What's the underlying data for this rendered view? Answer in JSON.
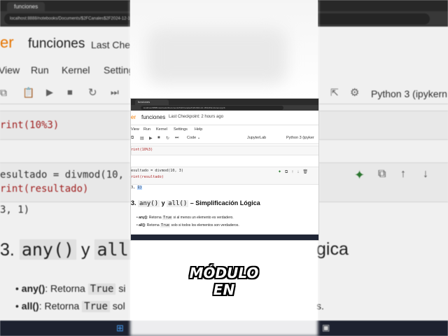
{
  "background": {
    "browser_tab": "funciones",
    "url": "localhost:8888/notebooks/Documents/$2FCanales$2F2024-12-16$2FFunciones.ipynb",
    "notebook_title": "funciones",
    "checkpoint": "Last Checkpoint",
    "logo_fragment": "er",
    "menu": [
      "View",
      "Run",
      "Kernel",
      "Setting"
    ],
    "kernel": "Python 3 (ipykern",
    "code_line_1": "rint(10%3)",
    "code_line_2": "esultado = divmod(10, 3",
    "code_line_3": "rint(resultado)",
    "output": "3, 1)",
    "heading_num": "3.",
    "heading_any": "any()",
    "heading_y": "y",
    "heading_all": "all",
    "heading_tail": "gica",
    "bullet_any_label": "any()",
    "bullet_any_text": ": Retorna",
    "bullet_any_code": "True",
    "bullet_any_rest": "si",
    "bullet_all_label": "all()",
    "bullet_all_text": ": Retorna",
    "bullet_all_code": "True",
    "bullet_all_rest": "sol",
    "bullet_all_end": "s."
  },
  "inner": {
    "browser_tab": "funciones",
    "url": "localhost:8888/notebooks/Documents/%2FCanales%2F2024-12-16%2Ffunciones.ipynb",
    "logo": "er",
    "notebook_title": "funciones",
    "checkpoint": "Last Checkpoint: 2 hours ago",
    "menu": [
      "View",
      "Run",
      "Kernel",
      "Settings",
      "Help"
    ],
    "cell_type": "Code",
    "jupyterlab": "JupyterLab",
    "kernel": "Python 3 (ipyker",
    "code_1": "rint(10%3)",
    "code_2": "esultado = divmod(10, 3)",
    "code_3": "rint(resultado)",
    "output_pre": "3, ",
    "output_sel": "1)",
    "heading_num": "3.",
    "heading_any": "any()",
    "heading_y": "y",
    "heading_all": "all()",
    "heading_rest": "– Simplificación Lógica",
    "bullet_any_label": "any()",
    "bullet_any_pre": ": Retorna",
    "bullet_any_code": "True",
    "bullet_any_post": "si al menos un elemento es verdadero.",
    "bullet_all_label": "all()",
    "bullet_all_pre": ": Retorna",
    "bullet_all_code": "True",
    "bullet_all_post": "solo si todos los elementos son verdaderos."
  },
  "caption": "MÓDULO EN",
  "colors": {
    "logo_orange": "#f57c00",
    "selection": "#b3d4ff",
    "taskbar": "#202636"
  }
}
